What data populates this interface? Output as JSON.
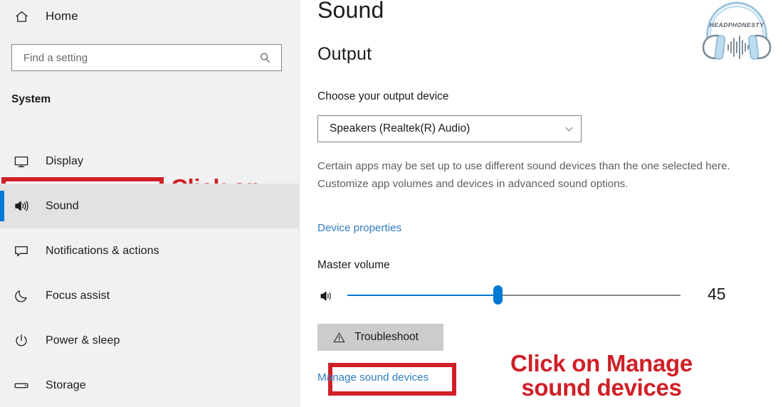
{
  "sidebar": {
    "home": {
      "label": "Home",
      "icon": "home-icon"
    },
    "search": {
      "placeholder": "Find a setting",
      "value": "",
      "icon": "search-icon"
    },
    "section_title": "System",
    "items": [
      {
        "label": "Display",
        "icon": "monitor-icon",
        "selected": false
      },
      {
        "label": "Sound",
        "icon": "speaker-icon",
        "selected": true
      },
      {
        "label": "Notifications & actions",
        "icon": "chat-bubble-icon",
        "selected": false
      },
      {
        "label": "Focus assist",
        "icon": "moon-icon",
        "selected": false
      },
      {
        "label": "Power & sleep",
        "icon": "power-icon",
        "selected": false
      },
      {
        "label": "Storage",
        "icon": "drive-icon",
        "selected": false
      }
    ]
  },
  "content": {
    "page_title": "Sound",
    "output_section_title": "Output",
    "output_device_label": "Choose your output device",
    "output_device_value": "Speakers (Realtek(R) Audio)",
    "output_device_options": [
      "Speakers (Realtek(R) Audio)"
    ],
    "description": "Certain apps may be set up to use different sound devices than the one selected here. Customize app volumes and devices in advanced sound options.",
    "device_properties_link": "Device properties",
    "master_volume_label": "Master volume",
    "master_volume_value": "45",
    "master_volume_percent": 45,
    "troubleshoot_label": "Troubleshoot",
    "manage_sound_devices_link": "Manage sound devices"
  },
  "logo": {
    "wordmark": "HEADPHONESTY"
  },
  "annotations": [
    {
      "id": "sound-tab",
      "text": "Click on\nSound Tab",
      "color": "#cf2027"
    },
    {
      "id": "manage-devices",
      "text": "Click on Manage\nsound devices",
      "color": "#cf2027"
    }
  ],
  "colors": {
    "accent_blue": "#0078d4",
    "link_blue": "#2f7dc1",
    "annotation_red": "#cf2027",
    "sidebar_bg": "#f1f1f1",
    "selected_bg": "#e2e2e2",
    "button_bg": "#cccccc"
  }
}
